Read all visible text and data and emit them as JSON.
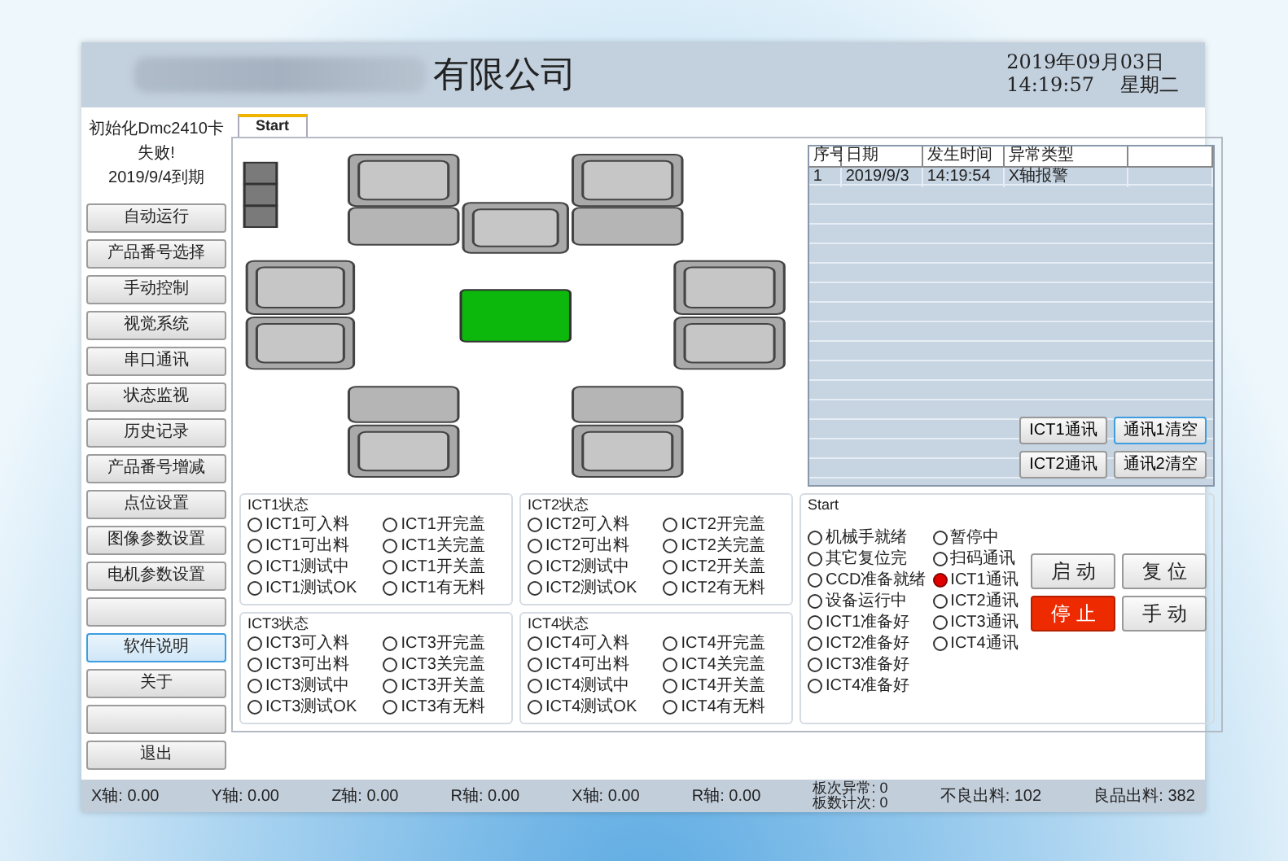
{
  "header": {
    "company_name": "有限公司",
    "date": "2019年09月03日",
    "time": "14:19:57",
    "weekday": "星期二"
  },
  "sidebar": {
    "message_lines": [
      "初始化Dmc2410卡",
      "失败!"
    ],
    "expiry": "2019/9/4到期",
    "buttons": [
      {
        "kind": "label",
        "label": "自动运行",
        "selected": false
      },
      {
        "kind": "label",
        "label": "产品番号选择",
        "selected": false
      },
      {
        "kind": "label",
        "label": "手动控制",
        "selected": false
      },
      {
        "kind": "label",
        "label": "视觉系统",
        "selected": false
      },
      {
        "kind": "label",
        "label": "串口通讯",
        "selected": false
      },
      {
        "kind": "label",
        "label": "状态监视",
        "selected": false
      },
      {
        "kind": "label",
        "label": "历史记录",
        "selected": false
      },
      {
        "kind": "label",
        "label": "产品番号增减",
        "selected": false
      },
      {
        "kind": "label",
        "label": "点位设置",
        "selected": false
      },
      {
        "kind": "label",
        "label": "图像参数设置",
        "selected": false
      },
      {
        "kind": "label",
        "label": "电机参数设置",
        "selected": false
      },
      {
        "kind": "blank",
        "selected": false
      },
      {
        "kind": "label",
        "label": "软件说明",
        "selected": true
      },
      {
        "kind": "label",
        "label": "关于",
        "selected": false
      },
      {
        "kind": "blank",
        "selected": false
      },
      {
        "kind": "label",
        "label": "退出",
        "selected": false
      }
    ]
  },
  "tabs": [
    {
      "label": "Start",
      "selected": true
    }
  ],
  "alarm_table": {
    "columns": [
      "序号",
      "日期",
      "发生时间",
      "异常类型"
    ],
    "rows": [
      [
        "1",
        "2019/9/3",
        "14:19:54",
        "X轴报警"
      ]
    ],
    "buttons": [
      {
        "label": "ICT1通讯",
        "selected": false
      },
      {
        "label": "通讯1清空",
        "selected": true
      },
      {
        "label": "ICT2通讯",
        "selected": false
      },
      {
        "label": "通讯2清空",
        "selected": false
      }
    ]
  },
  "ict_groups": [
    {
      "title": "ICT1状态",
      "indicators": [
        {
          "label": "ICT1可入料",
          "on": false
        },
        {
          "label": "ICT1可出料",
          "on": false
        },
        {
          "label": "ICT1测试中",
          "on": false
        },
        {
          "label": "ICT1测试OK",
          "on": false
        },
        {
          "label": "ICT1开完盖",
          "on": false
        },
        {
          "label": "ICT1关完盖",
          "on": false
        },
        {
          "label": "ICT1开关盖",
          "on": false
        },
        {
          "label": "ICT1有无料",
          "on": false
        }
      ]
    },
    {
      "title": "ICT2状态",
      "indicators": [
        {
          "label": "ICT2可入料",
          "on": false
        },
        {
          "label": "ICT2可出料",
          "on": false
        },
        {
          "label": "ICT2测试中",
          "on": false
        },
        {
          "label": "ICT2测试OK",
          "on": false
        },
        {
          "label": "ICT2开完盖",
          "on": false
        },
        {
          "label": "ICT2关完盖",
          "on": false
        },
        {
          "label": "ICT2开关盖",
          "on": false
        },
        {
          "label": "ICT2有无料",
          "on": false
        }
      ]
    },
    {
      "title": "ICT3状态",
      "indicators": [
        {
          "label": "ICT3可入料",
          "on": false
        },
        {
          "label": "ICT3可出料",
          "on": false
        },
        {
          "label": "ICT3测试中",
          "on": false
        },
        {
          "label": "ICT3测试OK",
          "on": false
        },
        {
          "label": "ICT3开完盖",
          "on": false
        },
        {
          "label": "ICT3关完盖",
          "on": false
        },
        {
          "label": "ICT3开关盖",
          "on": false
        },
        {
          "label": "ICT3有无料",
          "on": false
        }
      ]
    },
    {
      "title": "ICT4状态",
      "indicators": [
        {
          "label": "ICT4可入料",
          "on": false
        },
        {
          "label": "ICT4可出料",
          "on": false
        },
        {
          "label": "ICT4测试中",
          "on": false
        },
        {
          "label": "ICT4测试OK",
          "on": false
        },
        {
          "label": "ICT4开完盖",
          "on": false
        },
        {
          "label": "ICT4关完盖",
          "on": false
        },
        {
          "label": "ICT4开关盖",
          "on": false
        },
        {
          "label": "ICT4有无料",
          "on": false
        }
      ]
    }
  ],
  "start_panel": {
    "title": "Start",
    "indicators": [
      {
        "label": "机械手就绪",
        "on": false
      },
      {
        "label": "其它复位完",
        "on": false
      },
      {
        "label": "CCD准备就绪",
        "on": false
      },
      {
        "label": "设备运行中",
        "on": false
      },
      {
        "label": "ICT1准备好",
        "on": false
      },
      {
        "label": "ICT2准备好",
        "on": false
      },
      {
        "label": "ICT3准备好",
        "on": false
      },
      {
        "label": "ICT4准备好",
        "on": false
      },
      {
        "label": "暂停中",
        "on": false
      },
      {
        "label": "扫码通讯",
        "on": false
      },
      {
        "label": "ICT1通讯",
        "on": true
      },
      {
        "label": "ICT2通讯",
        "on": false
      },
      {
        "label": "ICT3通讯",
        "on": false
      },
      {
        "label": "ICT4通讯",
        "on": false
      }
    ],
    "buttons": [
      {
        "label": "启 动",
        "kind": "normal"
      },
      {
        "label": "复 位",
        "kind": "normal"
      },
      {
        "label": "停 止",
        "kind": "stop"
      },
      {
        "label": "手 动",
        "kind": "normal"
      }
    ]
  },
  "status_bar": {
    "axes": [
      "X轴: 0.00",
      "Y轴: 0.00",
      "Z轴: 0.00",
      "R轴: 0.00",
      "X轴: 0.00",
      "R轴: 0.00"
    ],
    "counters": [
      "板次异常: 0",
      "板数计次: 0"
    ],
    "outputs": [
      "不良出料: 102",
      "良品出料: 382"
    ]
  }
}
